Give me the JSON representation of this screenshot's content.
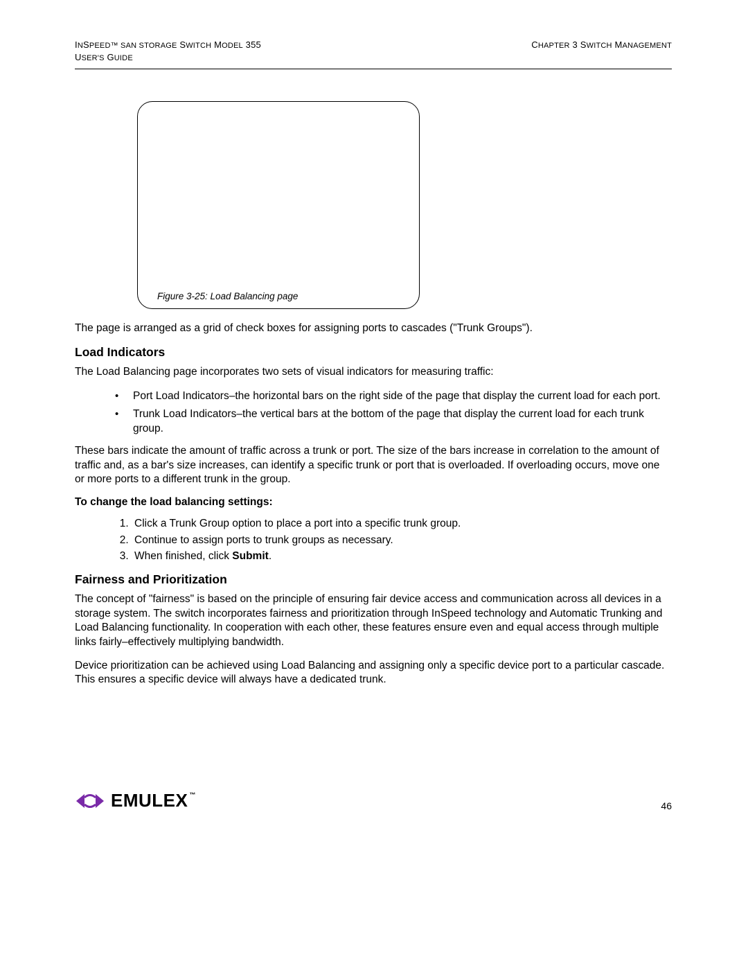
{
  "header": {
    "left_line1_a": "I",
    "left_line1_b": "n",
    "left_line1_c": "S",
    "left_line1_d": "peed™ SAN S",
    "left_line1_e": "torage",
    "left_line1_f": " S",
    "left_line1_g": "witch",
    "left_line1_h": " M",
    "left_line1_i": "odel",
    "left_line1_j": " 355",
    "left_line2_a": "U",
    "left_line2_b": "ser's",
    "left_line2_c": " G",
    "left_line2_d": "uide",
    "right_a": "C",
    "right_b": "hapter",
    "right_c": " 3 S",
    "right_d": "witch",
    "right_e": " M",
    "right_f": "anagement"
  },
  "figure": {
    "caption": "Figure 3-25: Load Balancing page"
  },
  "para1": "The page is arranged as a grid of check boxes for assigning ports to cascades (\"Trunk Groups\").",
  "section1": {
    "title": "Load Indicators",
    "intro": "The Load Balancing page incorporates two sets of visual indicators for measuring traffic:",
    "bullets": [
      "Port Load Indicators–the horizontal bars on the right side of the page that display the current load for each port.",
      "Trunk Load Indicators–the vertical bars at the bottom of the page that display the current load for each trunk group."
    ],
    "after_bullets": "These bars indicate the amount of traffic across a trunk or port. The size of the bars increase in correlation to the amount of traffic and, as a bar's size increases, can identify a specific trunk or port that is overloaded. If overloading occurs, move one or more ports to a different trunk in the group.",
    "steps_lead": "To change the load balancing settings:",
    "steps": [
      "Click a Trunk Group option to place a port into a specific trunk group.",
      "Continue to assign ports to trunk groups as necessary."
    ],
    "step3_prefix": "When finished, click ",
    "step3_bold": "Submit",
    "step3_suffix": "."
  },
  "section2": {
    "title": "Fairness and Prioritization",
    "p1": "The concept of \"fairness\" is based on the principle of ensuring fair device access and communication across all devices in a storage system. The switch incorporates fairness and prioritization through InSpeed technology and Automatic Trunking and Load Balancing functionality. In cooperation with each other, these features ensure even and equal access through multiple links fairly–effectively multiplying bandwidth.",
    "p2": "Device prioritization can be achieved using Load Balancing and assigning only a specific device port to a particular cascade. This ensures a specific device will always have a dedicated trunk."
  },
  "footer": {
    "brand": "EMULEX",
    "tm": "™",
    "page_number": "46"
  }
}
